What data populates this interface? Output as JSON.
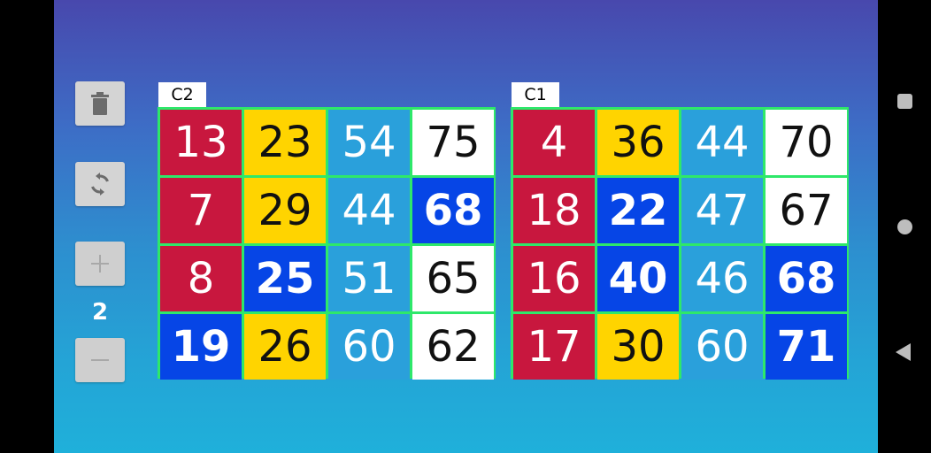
{
  "controls": {
    "delete_icon": "trash-icon",
    "refresh_icon": "refresh-icon",
    "add_icon": "plus-icon",
    "remove_icon": "minus-icon",
    "card_count": "2"
  },
  "cards": [
    {
      "label": "C2",
      "cells": [
        [
          {
            "n": "13",
            "c": "red"
          },
          {
            "n": "23",
            "c": "yellow"
          },
          {
            "n": "54",
            "c": "lblue"
          },
          {
            "n": "75",
            "c": "white"
          }
        ],
        [
          {
            "n": "7",
            "c": "red"
          },
          {
            "n": "29",
            "c": "yellow"
          },
          {
            "n": "44",
            "c": "lblue"
          },
          {
            "n": "68",
            "c": "blue"
          }
        ],
        [
          {
            "n": "8",
            "c": "red"
          },
          {
            "n": "25",
            "c": "blue"
          },
          {
            "n": "51",
            "c": "lblue"
          },
          {
            "n": "65",
            "c": "white"
          }
        ],
        [
          {
            "n": "19",
            "c": "blue"
          },
          {
            "n": "26",
            "c": "yellow"
          },
          {
            "n": "60",
            "c": "lblue"
          },
          {
            "n": "62",
            "c": "white"
          }
        ]
      ]
    },
    {
      "label": "C1",
      "cells": [
        [
          {
            "n": "4",
            "c": "red"
          },
          {
            "n": "36",
            "c": "yellow"
          },
          {
            "n": "44",
            "c": "lblue"
          },
          {
            "n": "70",
            "c": "white"
          }
        ],
        [
          {
            "n": "18",
            "c": "red"
          },
          {
            "n": "22",
            "c": "blue"
          },
          {
            "n": "47",
            "c": "lblue"
          },
          {
            "n": "67",
            "c": "white"
          }
        ],
        [
          {
            "n": "16",
            "c": "red"
          },
          {
            "n": "40",
            "c": "blue"
          },
          {
            "n": "46",
            "c": "lblue"
          },
          {
            "n": "68",
            "c": "blue"
          }
        ],
        [
          {
            "n": "17",
            "c": "red"
          },
          {
            "n": "30",
            "c": "yellow"
          },
          {
            "n": "60",
            "c": "lblue"
          },
          {
            "n": "71",
            "c": "blue"
          }
        ]
      ]
    }
  ],
  "colors": {
    "red": "#c8173e",
    "yellow": "#ffd400",
    "lblue": "#2aa0db",
    "white": "#ffffff",
    "blue": "#0645e6",
    "grid": "#2ee86a"
  },
  "nav": {
    "recents_icon": "square-icon",
    "home_icon": "circle-icon",
    "back_icon": "back-triangle-icon"
  }
}
